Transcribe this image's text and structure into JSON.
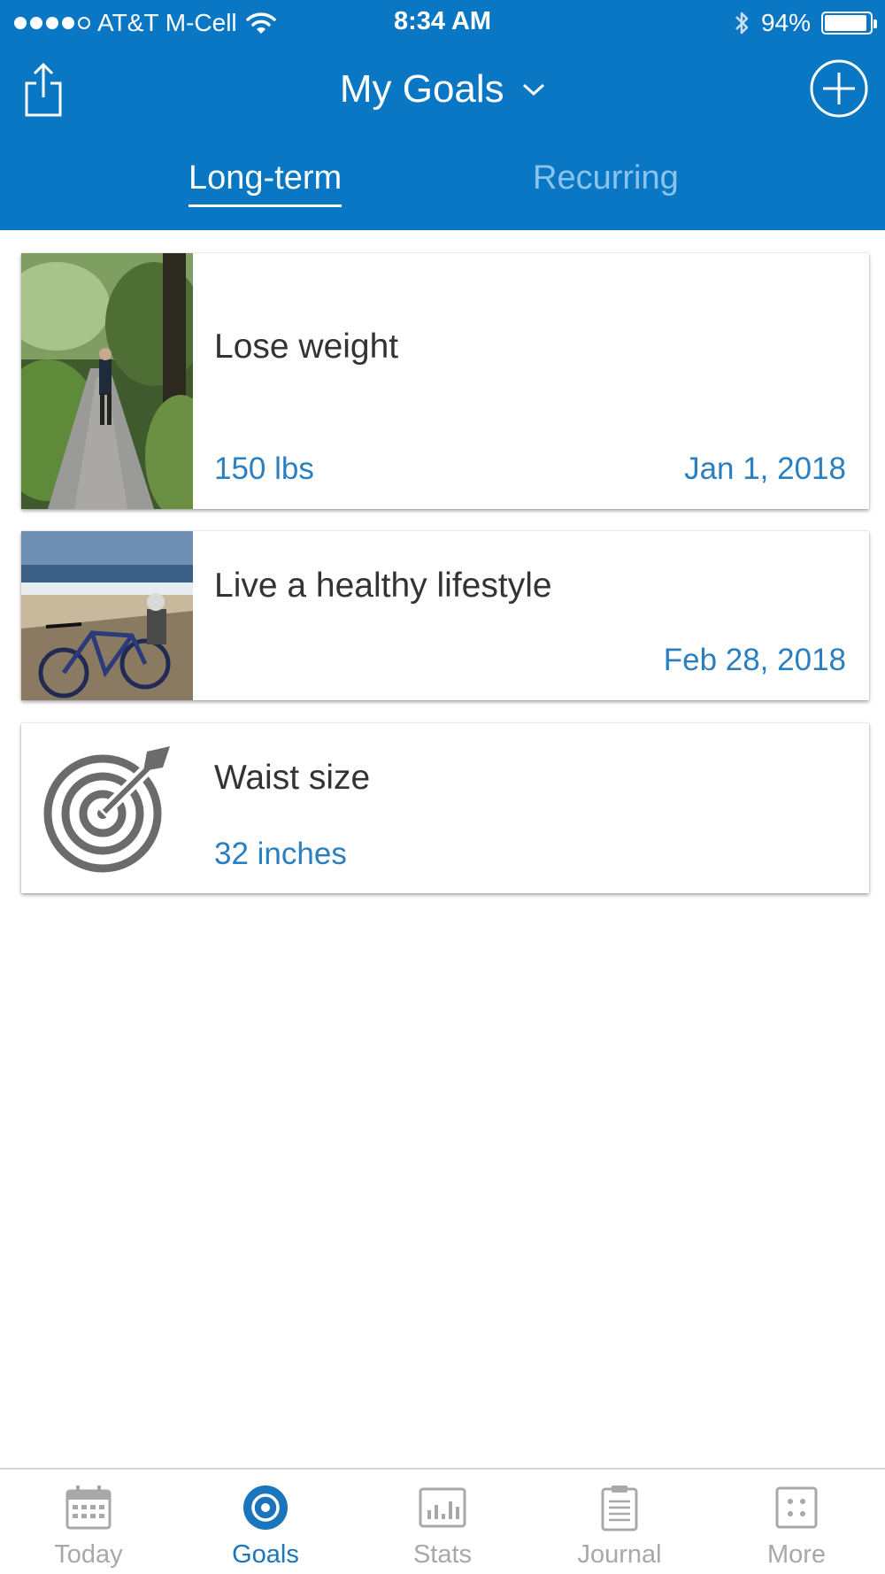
{
  "status_bar": {
    "carrier": "AT&T M-Cell",
    "time": "8:34 AM",
    "battery_percent": "94%",
    "battery_level": 0.94,
    "signal_bars_filled": 4,
    "signal_bars_total": 5
  },
  "nav": {
    "title": "My Goals",
    "share_icon": "share-icon",
    "add_icon": "add-circle-icon",
    "dropdown_icon": "chevron-down-icon"
  },
  "tabs": [
    {
      "label": "Long-term",
      "selected": true
    },
    {
      "label": "Recurring",
      "selected": false
    }
  ],
  "goals": [
    {
      "title": "Lose weight",
      "value": "150 lbs",
      "date": "Jan 1, 2018",
      "image": "photo-forest-path"
    },
    {
      "title": "Live a healthy lifestyle",
      "value": "",
      "date": "Feb 28, 2018",
      "image": "photo-beach-bicycle"
    },
    {
      "title": "Waist size",
      "value": "32 inches",
      "date": "",
      "image": "target-icon"
    }
  ],
  "tabbar": [
    {
      "label": "Today",
      "icon": "calendar-icon",
      "active": false
    },
    {
      "label": "Goals",
      "icon": "target-icon",
      "active": true
    },
    {
      "label": "Stats",
      "icon": "bar-chart-icon",
      "active": false
    },
    {
      "label": "Journal",
      "icon": "clipboard-icon",
      "active": false
    },
    {
      "label": "More",
      "icon": "more-grid-icon",
      "active": false
    }
  ],
  "colors": {
    "header": "#0a77c4",
    "accent": "#2a7fc0",
    "inactive_tab": "#8cc3ec",
    "tabbar_inactive": "#a8a8a8"
  }
}
